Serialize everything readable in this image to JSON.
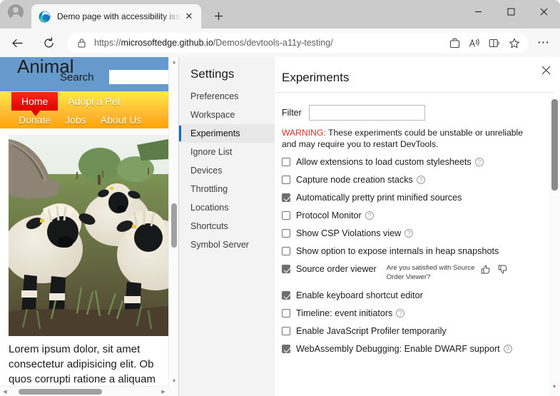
{
  "browser": {
    "tab": {
      "title": "Demo page with accessibility issues",
      "favicon_name": "edge-favicon",
      "close_label": "✕"
    },
    "new_tab_label": "＋",
    "window_controls": {
      "minimize": "—",
      "maximize": "□",
      "close": "✕"
    },
    "toolbar": {
      "back_label": "←",
      "reload_label": "⟳",
      "url_scheme": "https://",
      "url_host": "microsoftedge.github.io",
      "url_path": "/Demos/devtools-a11y-testing/",
      "collections_label": "collections-icon",
      "read_aloud_label": "read-aloud-icon",
      "split_screen_label": "split-screen-icon",
      "favorite_label": "☆",
      "more_label": "⋯"
    }
  },
  "page": {
    "site_title": "Animal",
    "search_label": "Search",
    "search_value": "",
    "search_placeholder": "",
    "nav_row1": [
      "Home",
      "Adopt a Pet"
    ],
    "nav_row2": [
      "Donate",
      "Jobs",
      "About Us"
    ],
    "active_nav": "Home",
    "image_alt": "Three Valais Blacknose sheep standing in a grassy field beside a large tree",
    "paragraph": "Lorem ipsum dolor, sit amet consectetur adipisicing elit. Ob quos corrupti ratione a aliquam",
    "colors": {
      "header_bg": "#6699cc",
      "nav_gradient_top": "#ffe94d",
      "nav_gradient_bottom": "#ffa500",
      "active_nav_bg": "#e00000"
    },
    "scrollbars": {
      "vertical_up": "▲",
      "vertical_down": "▼",
      "horizontal_left": "◀",
      "horizontal_right": "▶"
    }
  },
  "devtools": {
    "settings_heading": "Settings",
    "nav_items": [
      {
        "label": "Preferences",
        "active": false
      },
      {
        "label": "Workspace",
        "active": false
      },
      {
        "label": "Experiments",
        "active": true
      },
      {
        "label": "Ignore List",
        "active": false
      },
      {
        "label": "Devices",
        "active": false
      },
      {
        "label": "Throttling",
        "active": false
      },
      {
        "label": "Locations",
        "active": false
      },
      {
        "label": "Shortcuts",
        "active": false
      },
      {
        "label": "Symbol Server",
        "active": false
      }
    ],
    "panel_title": "Experiments",
    "close_label": "✕",
    "filter_label": "Filter",
    "filter_value": "",
    "filter_placeholder": "",
    "warning_prefix": "WARNING:",
    "warning_text": " These experiments could be unstable or unreliable and may require you to restart DevTools.",
    "accent_color": "#0f6cbd",
    "warning_color": "#d93025",
    "experiments": [
      {
        "label": "Allow extensions to load custom stylesheets",
        "checked": false,
        "help": true
      },
      {
        "label": "Capture node creation stacks",
        "checked": false,
        "help": true
      },
      {
        "label": "Automatically pretty print minified sources",
        "checked": true,
        "help": false
      },
      {
        "label": "Protocol Monitor",
        "checked": false,
        "help": true
      },
      {
        "label": "Show CSP Violations view",
        "checked": false,
        "help": true
      },
      {
        "label": "Show option to expose internals in heap snapshots",
        "checked": false,
        "help": false
      },
      {
        "label": "Source order viewer",
        "checked": true,
        "help": false,
        "feedback_question": "Are you satisfied with Source Order Viewer?",
        "thumb_up": "thumb-up-icon",
        "thumb_down": "thumb-down-icon"
      },
      {
        "label": "Enable keyboard shortcut editor",
        "checked": true,
        "help": false
      },
      {
        "label": "Timeline: event initiators",
        "checked": false,
        "help": true
      },
      {
        "label": "Enable JavaScript Profiler temporarily",
        "checked": false,
        "help": false
      },
      {
        "label": "WebAssembly Debugging: Enable DWARF support",
        "checked": true,
        "help": true
      }
    ],
    "help_glyph": "?",
    "scrollbar_down": "▼"
  }
}
